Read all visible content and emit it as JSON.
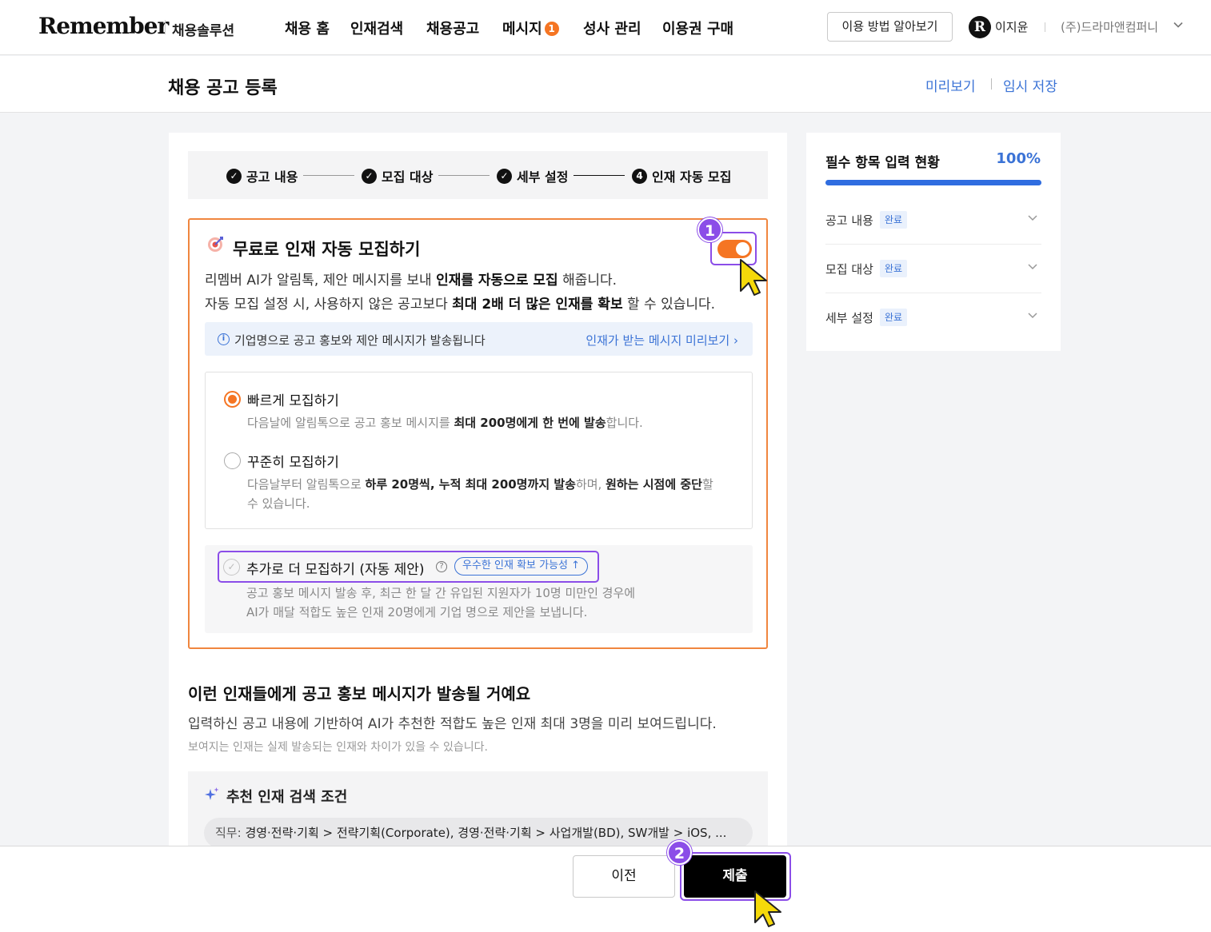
{
  "nav": {
    "logo": "Remember",
    "logo_sub": "채용솔루션",
    "items": [
      {
        "label": "채용 홈"
      },
      {
        "label": "인재검색"
      },
      {
        "label": "채용공고"
      },
      {
        "label": "메시지",
        "badge": "1"
      },
      {
        "label": "성사 관리"
      },
      {
        "label": "이용권 구매"
      }
    ],
    "guide_button": "이용 방법 알아보기",
    "avatar_letter": "R",
    "user_name": "이지윤",
    "company": "(주)드라마앤컴퍼니"
  },
  "page": {
    "title": "채용 공고 등록",
    "preview_link": "미리보기",
    "draft_link": "임시 저장"
  },
  "stepper": {
    "steps": [
      {
        "label": "공고 내용",
        "status": "done"
      },
      {
        "label": "모집 대상",
        "status": "done"
      },
      {
        "label": "세부 설정",
        "status": "done"
      },
      {
        "label": "인재 자동 모집",
        "status": "current",
        "number": "4"
      }
    ]
  },
  "auto_recruit": {
    "title": "무료로 인재 자동 모집하기",
    "toggle_on": true,
    "desc1_a": "리멤버 AI가 알림톡, 제안 메시지를 보내 ",
    "desc1_b": "인재를 자동으로 모집",
    "desc1_c": " 해줍니다.",
    "desc2_a": "자동 모집 설정 시, 사용하지 않은 공고보다 ",
    "desc2_b": "최대 2배 더 많은 인재를 확보",
    "desc2_c": " 할 수 있습니다.",
    "info_text": "기업명으로 공고 홍보와 제안 메시지가 발송됩니다",
    "info_link": "인재가 받는 메시지 미리보기",
    "options": [
      {
        "title": "빠르게 모집하기",
        "selected": true,
        "desc_a": "다음날에 알림톡으로 공고 홍보 메시지를 ",
        "desc_b": "최대 200명에게 한 번에 발송",
        "desc_c": "합니다."
      },
      {
        "title": "꾸준히 모집하기",
        "selected": false,
        "desc_a": "다음날부터 알림톡으로 ",
        "desc_b": "하루 20명씩, 누적 최대 200명까지 발송",
        "desc_c": "하며, ",
        "desc_d": "원하는 시점에 중단",
        "desc_e": "할",
        "desc_f": "수 있습니다."
      }
    ],
    "extra": {
      "title": "추가로 더 모집하기 (자동 제안)",
      "help": "?",
      "pill": "우수한 인재 확보 가능성",
      "desc1": "공고 홍보 메시지 발송 후, 최근 한 달 간 유입된 지원자가 10명 미만인 경우에",
      "desc2": "AI가 매달 적합도 높은 인재 20명에게 기업 명으로 제안을 보냅니다."
    }
  },
  "recommend": {
    "title": "이런 인재들에게 공고 홍보 메시지가 발송될 거예요",
    "desc": "입력하신 공고 내용에 기반하여 AI가 추천한 적합도 높은 인재 최대 3명을 미리 보여드립니다.",
    "note": "보여지는 인재는 실제 발송되는 인재와 차이가 있을 수 있습니다.",
    "criteria_title": "추천 인재 검색 조건",
    "criteria_key": "직무: ",
    "criteria_value": "경영·전략·기획 > 전략기획(Corporate), 경영·전략·기획 > 사업개발(BD), SW개발 > iOS, ..."
  },
  "sidebar": {
    "title": "필수 항목 입력 현황",
    "percent_label": "100%",
    "progress": 1.0,
    "rows": [
      {
        "label": "공고 내용",
        "badge": "완료"
      },
      {
        "label": "모집 대상",
        "badge": "완료"
      },
      {
        "label": "세부 설정",
        "badge": "완료"
      }
    ]
  },
  "bottom": {
    "prev": "이전",
    "submit": "제출"
  },
  "annotations": {
    "marker1": "1",
    "marker2": "2"
  },
  "colors": {
    "accent_orange": "#f57523",
    "link_blue": "#3b73d6",
    "highlight_purple": "#8b4de8",
    "cursor_yellow": "#f5d90a"
  }
}
